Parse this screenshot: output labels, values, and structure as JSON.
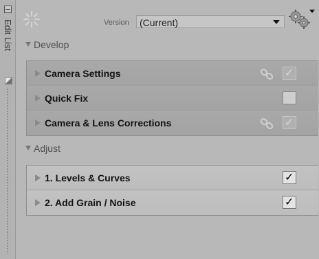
{
  "side_panel": {
    "title": "Edit List"
  },
  "version": {
    "label": "Version",
    "value": "(Current)"
  },
  "sections": {
    "develop": {
      "title": "Develop"
    },
    "adjust": {
      "title": "Adjust"
    }
  },
  "develop_rows": [
    {
      "label": "Camera Settings",
      "linked": true,
      "checked": true,
      "enabled": false
    },
    {
      "label": "Quick Fix",
      "linked": false,
      "checked": false,
      "enabled": true
    },
    {
      "label": "Camera & Lens Corrections",
      "linked": true,
      "checked": true,
      "enabled": false
    }
  ],
  "adjust_rows": [
    {
      "label": "1. Levels & Curves",
      "checked": true,
      "enabled": true
    },
    {
      "label": "2. Add Grain / Noise",
      "checked": true,
      "enabled": true
    }
  ],
  "colors": {
    "panel_bg": "#b8b8b8",
    "develop_row_bg": "#a6a6a6",
    "adjust_row_bg": "#c0c0c0"
  }
}
